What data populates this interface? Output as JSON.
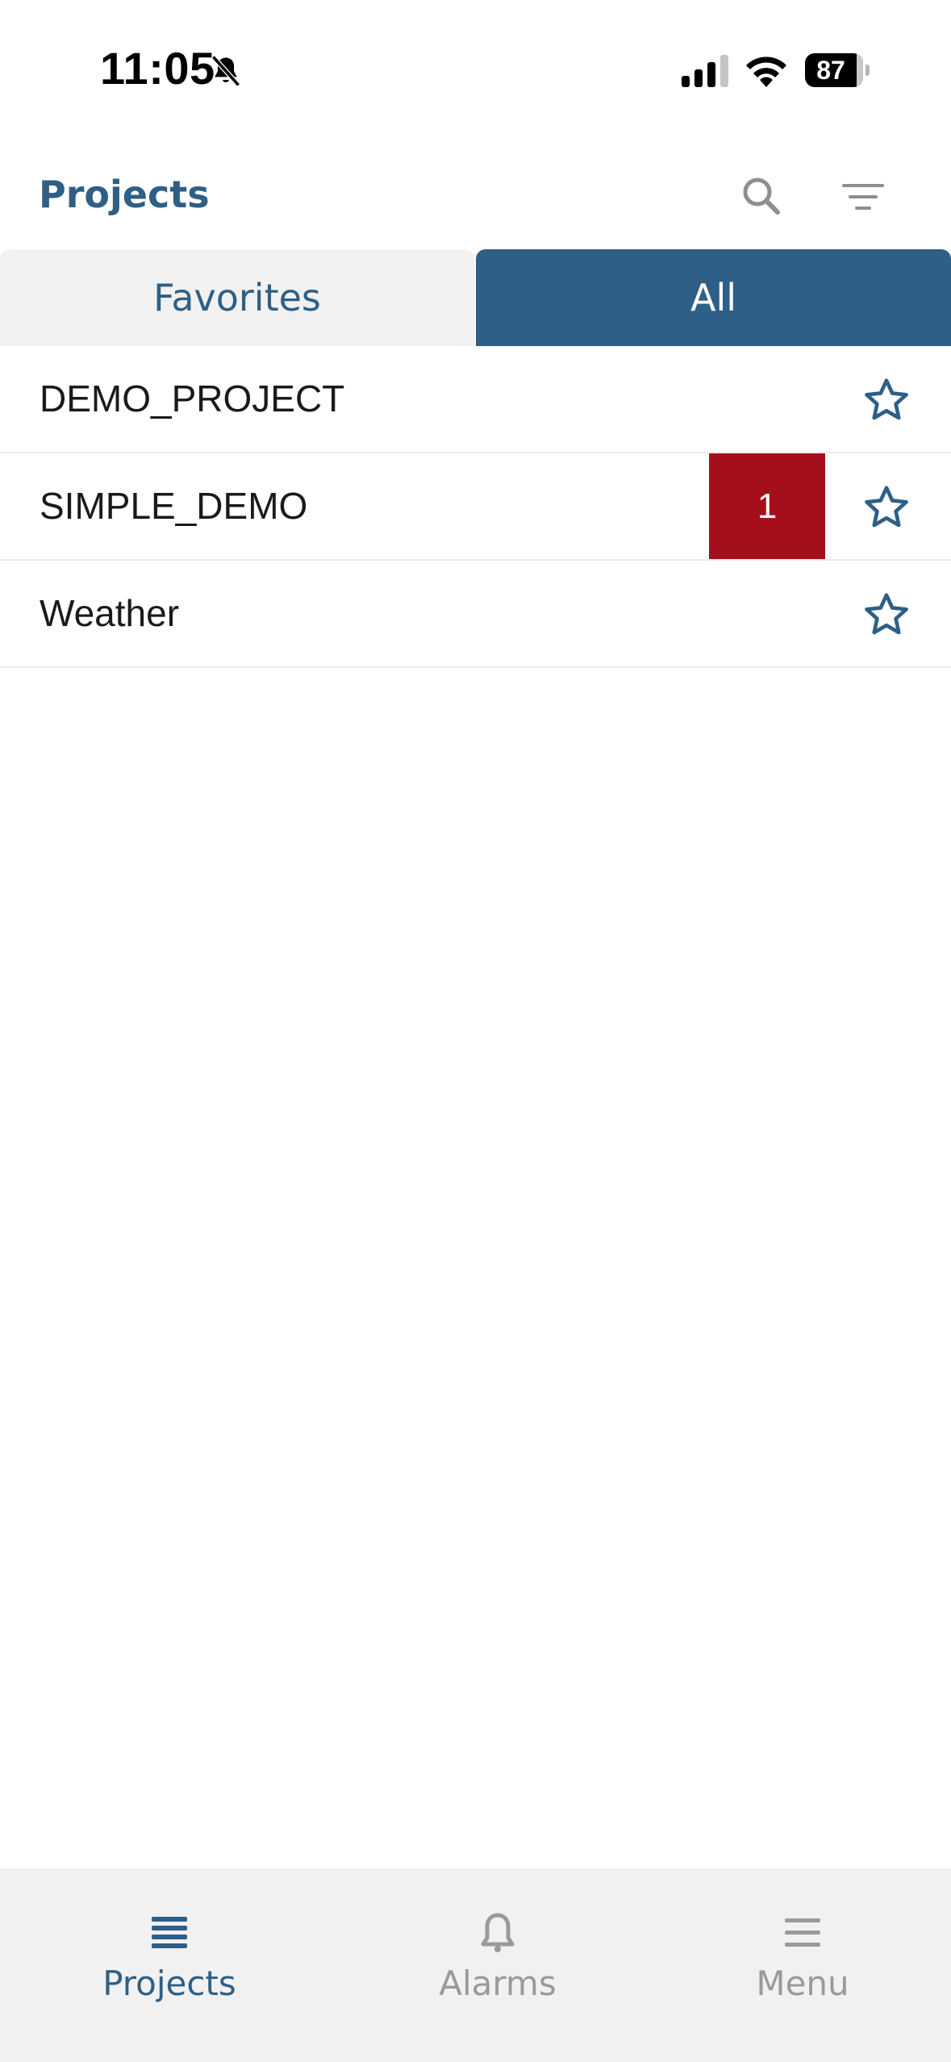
{
  "status_bar": {
    "time": "11:05",
    "battery_level": "87",
    "icons": [
      "bell-slash-icon",
      "cellular-signal-icon",
      "wifi-icon",
      "battery-icon"
    ]
  },
  "header": {
    "title": "Projects",
    "icons": [
      "search-icon",
      "filter-icon"
    ]
  },
  "tabs": [
    {
      "label": "Favorites",
      "selected": false
    },
    {
      "label": "All",
      "selected": true
    }
  ],
  "projects": [
    {
      "name": "DEMO_PROJECT",
      "alarm_count": null,
      "favorite": false
    },
    {
      "name": "SIMPLE_DEMO",
      "alarm_count": "1",
      "favorite": false
    },
    {
      "name": "Weather",
      "alarm_count": null,
      "favorite": false
    }
  ],
  "bottom_nav": [
    {
      "label": "Projects",
      "icon": "list-icon",
      "active": true
    },
    {
      "label": "Alarms",
      "icon": "bell-icon",
      "active": false
    },
    {
      "label": "Menu",
      "icon": "menu-icon",
      "active": false
    }
  ],
  "colors": {
    "primary": "#2e5f86",
    "alarm": "#a50f1c",
    "tab_inactive_bg": "#f1f1f1",
    "nav_inactive": "#9a9a9a"
  }
}
